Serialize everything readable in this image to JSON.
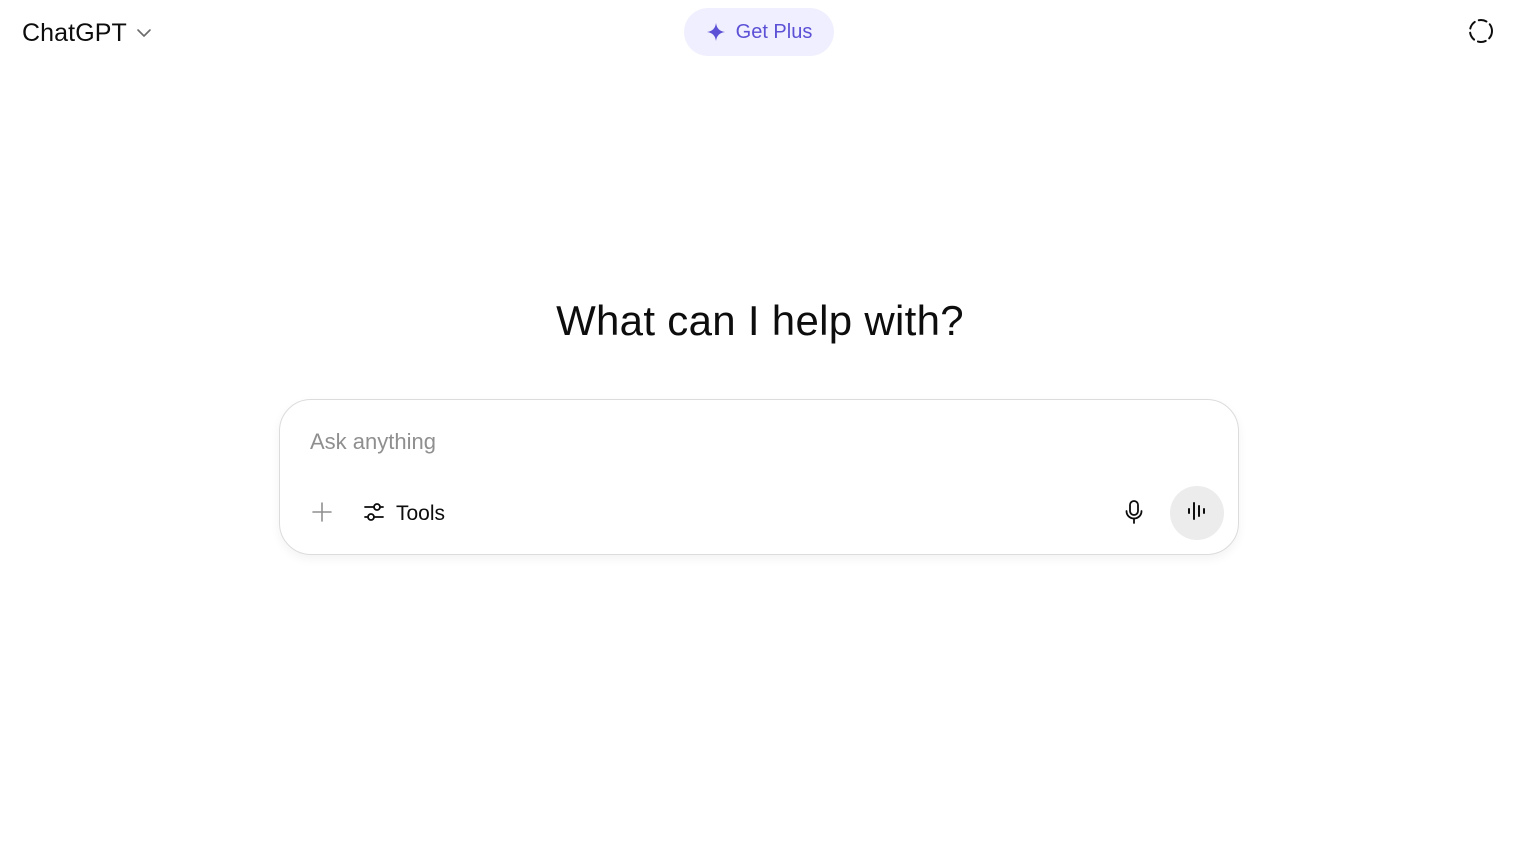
{
  "header": {
    "model_name": "ChatGPT",
    "get_plus_label": "Get Plus",
    "accent_color": "#5b50d6",
    "get_plus_bg": "#f0efff"
  },
  "hero": {
    "title": "What can I help with?"
  },
  "composer": {
    "placeholder": "Ask anything",
    "value": "",
    "tools_label": "Tools",
    "icons": [
      "plus-icon",
      "sliders-icon",
      "microphone-icon",
      "voice-waveform-icon"
    ]
  },
  "header_icons": [
    "chevron-down-icon",
    "sparkle-icon",
    "temporary-chat-icon"
  ]
}
